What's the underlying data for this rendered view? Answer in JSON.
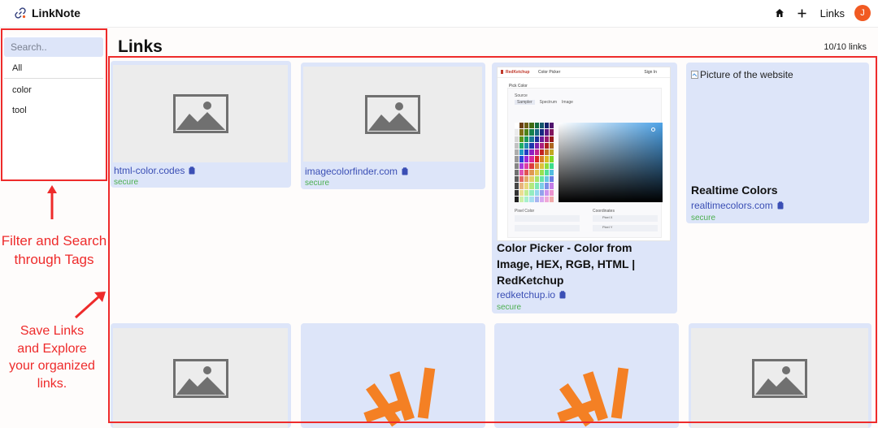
{
  "app": {
    "name": "LinkNote",
    "nav_links_label": "Links",
    "avatar_initial": "J",
    "accent_color": "#f15a22"
  },
  "sidebar": {
    "search_placeholder": "Search..",
    "tags": [
      "All",
      "color",
      "tool"
    ]
  },
  "main": {
    "title": "Links",
    "count_text": "10/10 links"
  },
  "cards": [
    {
      "domain": "html-color.codes",
      "secure": "secure",
      "thumb": "placeholder-image-icon"
    },
    {
      "domain": "imagecolorfinder.com",
      "secure": "secure",
      "thumb": "placeholder-image-icon"
    },
    {
      "title": "Color Picker - Color from Image, HEX, RGB, HTML | RedKetchup",
      "domain": "redketchup.io",
      "secure": "secure",
      "thumb": "screenshot",
      "shot": {
        "brand": "RedKetchup",
        "section": "Color Picker",
        "panel_title": "Pick Color",
        "source_label": "Source",
        "source_tabs": [
          "Sampler",
          "Spectrum",
          "Image"
        ],
        "pixel_color_label": "Pixel Color",
        "coordinates_label": "Coordinates",
        "pixel_x_label": "Pixel X",
        "pixel_y_label": "Pixel Y",
        "sign_in": "Sign In"
      }
    },
    {
      "alt_text": "Picture of the website",
      "title": "Realtime Colors",
      "domain": "realtimecolors.com",
      "secure": "secure",
      "thumb": "broken"
    },
    {
      "thumb": "placeholder-image-icon"
    },
    {
      "thumb": "stackoverflow-logo"
    },
    {
      "thumb": "stackoverflow-logo"
    },
    {
      "thumb": "placeholder-image-icon"
    }
  ],
  "annotations": {
    "filter_text": "Filter and Search through Tags",
    "save_text": "Save Links and Explore your organized links.",
    "color": "#ee2b2b"
  },
  "colors": {
    "card_bg": "#dde5f9",
    "domain_link": "#3b4fb5",
    "secure_green": "#4caf50",
    "stackoverflow_orange": "#f48024"
  }
}
